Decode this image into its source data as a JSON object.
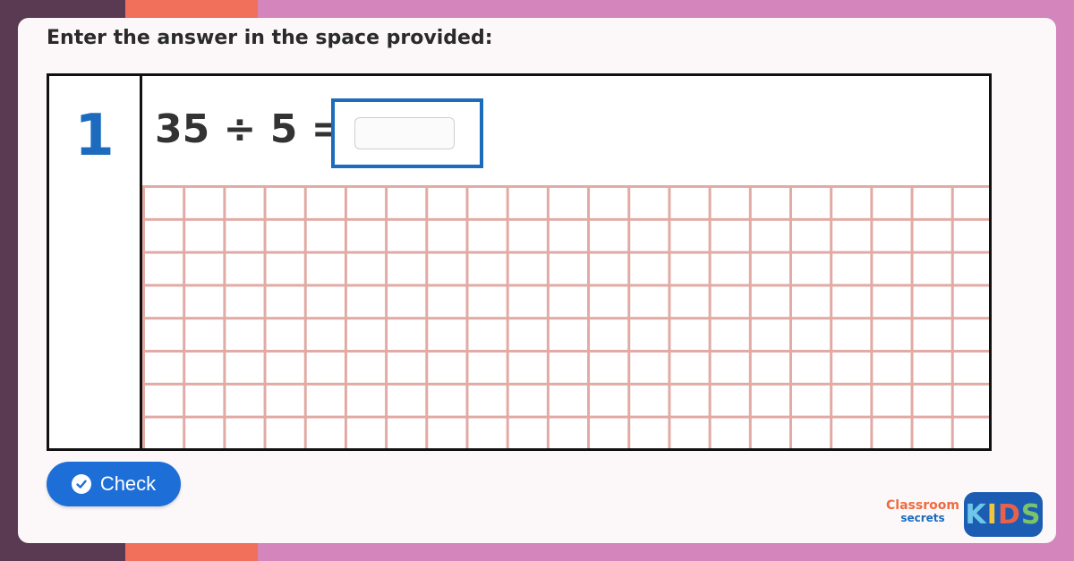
{
  "instruction": "Enter the answer in the space provided:",
  "question": {
    "number": "1",
    "equation": "35 ÷ 5 =",
    "answer_value": "",
    "answer_placeholder": ""
  },
  "check_button": {
    "label": "Check",
    "icon": "check-circle-icon"
  },
  "logo": {
    "line1": "Classroom",
    "line2": "secrets",
    "badge_letters": [
      "K",
      "I",
      "D",
      "S"
    ]
  },
  "colors": {
    "accent_blue": "#1c6bbd",
    "button_blue": "#1e6ed8",
    "grid_line": "#e2aaa4",
    "bg_pink": "#d385bc",
    "bg_orange": "#f0705c",
    "bg_dark": "#5a3a52"
  }
}
